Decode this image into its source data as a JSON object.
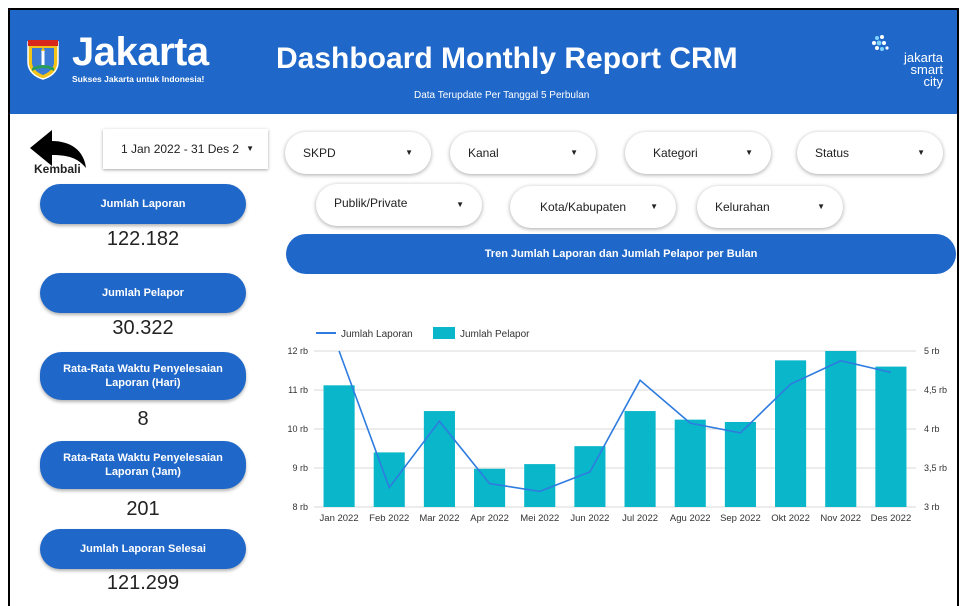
{
  "header": {
    "logo_word": "Jakarta",
    "logo_tagline": "Sukses Jakarta untuk Indonesia!",
    "title": "Dashboard Monthly Report CRM",
    "subtitle": "Data Terupdate Per Tanggal 5 Perbulan",
    "smart_city": [
      "jakarta",
      "smart",
      "city"
    ]
  },
  "nav": {
    "back_label": "Kembali"
  },
  "filters": {
    "date_range": "1 Jan 2022 - 31 Des 2",
    "dropdowns_row1": [
      "SKPD",
      "Kanal",
      "Kategori",
      "Status"
    ],
    "dropdowns_row2": [
      "Publik/Private",
      "Kota/Kabupaten",
      "Kelurahan"
    ]
  },
  "kpis": [
    {
      "label": "Jumlah Laporan",
      "value": "122.182"
    },
    {
      "label": "Jumlah Pelapor",
      "value": "30.322"
    },
    {
      "label": "Rata-Rata Waktu Penyelesaian Laporan (Hari)",
      "value": "8"
    },
    {
      "label": "Rata-Rata Waktu Penyelesaian Laporan (Jam)",
      "value": "201"
    },
    {
      "label": "Jumlah Laporan Selesai",
      "value": "121.299"
    }
  ],
  "chart_banner": "Tren Jumlah Laporan dan Jumlah Pelapor per Bulan",
  "colors": {
    "brand_blue": "#1f67c8",
    "bar_teal": "#0ab6c9",
    "line_blue": "#2e7ce0"
  },
  "chart_data": {
    "type": "bar",
    "categories": [
      "Jan 2022",
      "Feb 2022",
      "Mar 2022",
      "Apr 2022",
      "Mei 2022",
      "Jun 2022",
      "Jul 2022",
      "Agu 2022",
      "Sep 2022",
      "Okt 2022",
      "Nov 2022",
      "Des 2022"
    ],
    "series": [
      {
        "name": "Jumlah Laporan",
        "type": "line",
        "axis": "left",
        "values": [
          12000,
          8500,
          10200,
          8600,
          8400,
          8900,
          11250,
          10150,
          9900,
          11150,
          11750,
          11450
        ]
      },
      {
        "name": "Jumlah Pelapor",
        "type": "bar",
        "axis": "right",
        "values": [
          4560,
          3700,
          4230,
          3490,
          3550,
          3780,
          4230,
          4120,
          4090,
          4880,
          5000,
          4800
        ]
      }
    ],
    "y_left": {
      "ticks": [
        "8 rb",
        "9 rb",
        "10 rb",
        "11 rb",
        "12 rb"
      ],
      "ylim": [
        8000,
        12000
      ]
    },
    "y_right": {
      "ticks": [
        "3 rb",
        "3,5 rb",
        "4 rb",
        "4,5 rb",
        "5 rb"
      ],
      "ylim": [
        3000,
        5000
      ]
    },
    "legend": "top-left",
    "grid": true
  }
}
